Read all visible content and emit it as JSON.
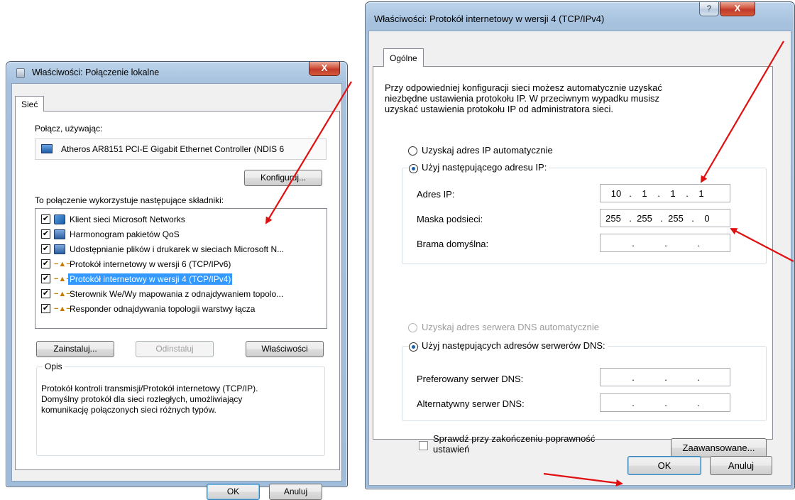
{
  "left_dialog": {
    "title": "Właściwości: Połączenie lokalne",
    "close": "X",
    "tab": "Sieć",
    "connect_using_label": "Połącz, używając:",
    "adapter": "Atheros AR8151 PCI-E Gigabit Ethernet Controller (NDIS 6",
    "configure_button": "Konfiguruj...",
    "components_label": "To połączenie wykorzystuje następujące składniki:",
    "components": [
      {
        "label": "Klient sieci Microsoft Networks",
        "checked": true,
        "icon": "network-client-icon"
      },
      {
        "label": "Harmonogram pakietów QoS",
        "checked": true,
        "icon": "computer-icon"
      },
      {
        "label": "Udostępnianie plików i drukarek w sieciach Microsoft N...",
        "checked": true,
        "icon": "computer-icon"
      },
      {
        "label": "Protokół internetowy w wersji 6 (TCP/IPv6)",
        "checked": true,
        "icon": "protocol-icon"
      },
      {
        "label": "Protokół internetowy w wersji 4 (TCP/IPv4)",
        "checked": true,
        "icon": "protocol-icon",
        "selected": true
      },
      {
        "label": "Sterownik We/Wy mapowania z odnajdywaniem topolo...",
        "checked": true,
        "icon": "protocol-icon"
      },
      {
        "label": "Responder odnajdywania topologii warstwy łącza",
        "checked": true,
        "icon": "protocol-icon"
      }
    ],
    "install_button": "Zainstaluj...",
    "uninstall_button": "Odinstaluj",
    "properties_button": "Właściwości",
    "description_title": "Opis",
    "description_text": [
      "Protokół kontroli transmisji/Protokół internetowy (TCP/IP).",
      "Domyślny protokół dla sieci rozległych, umożliwiający",
      "komunikację połączonych sieci różnych typów."
    ],
    "ok_button": "OK",
    "cancel_button": "Anuluj"
  },
  "right_dialog": {
    "title": "Właściwości: Protokół internetowy w wersji 4 (TCP/IPv4)",
    "help": "?",
    "close": "X",
    "tab": "Ogólne",
    "intro_text": [
      "Przy odpowiedniej konfiguracji sieci możesz automatycznie uzyskać",
      "niezbędne ustawienia protokołu IP. W przeciwnym wypadku musisz",
      "uzyskać ustawienia protokołu IP od administratora sieci."
    ],
    "radio_auto_ip": "Uzyskaj adres IP automatycznie",
    "radio_manual_ip": "Użyj następującego adresu IP:",
    "ip_label": "Adres IP:",
    "ip_octets": [
      "10",
      "1",
      "1",
      "1"
    ],
    "mask_label": "Maska podsieci:",
    "mask_octets": [
      "255",
      "255",
      "255",
      "0"
    ],
    "gateway_label": "Brama domyślna:",
    "gateway_octets": [
      "",
      "",
      "",
      ""
    ],
    "radio_auto_dns": "Uzyskaj adres serwera DNS automatycznie",
    "radio_manual_dns": "Użyj następujących adresów serwerów DNS:",
    "preferred_dns_label": "Preferowany serwer DNS:",
    "preferred_dns_octets": [
      "",
      "",
      "",
      ""
    ],
    "alternate_dns_label": "Alternatywny serwer DNS:",
    "alternate_dns_octets": [
      "",
      "",
      "",
      ""
    ],
    "validate_checkbox": "Sprawdź przy zakończeniu poprawność ustawień",
    "validate_line1": "Sprawdź przy zakończeniu poprawność",
    "validate_line2": "ustawień",
    "advanced_button": "Zaawansowane...",
    "ok_button": "OK",
    "cancel_button": "Anuluj"
  },
  "colors": {
    "annotation_arrow": "#e01010",
    "selection": "#3399ff"
  }
}
